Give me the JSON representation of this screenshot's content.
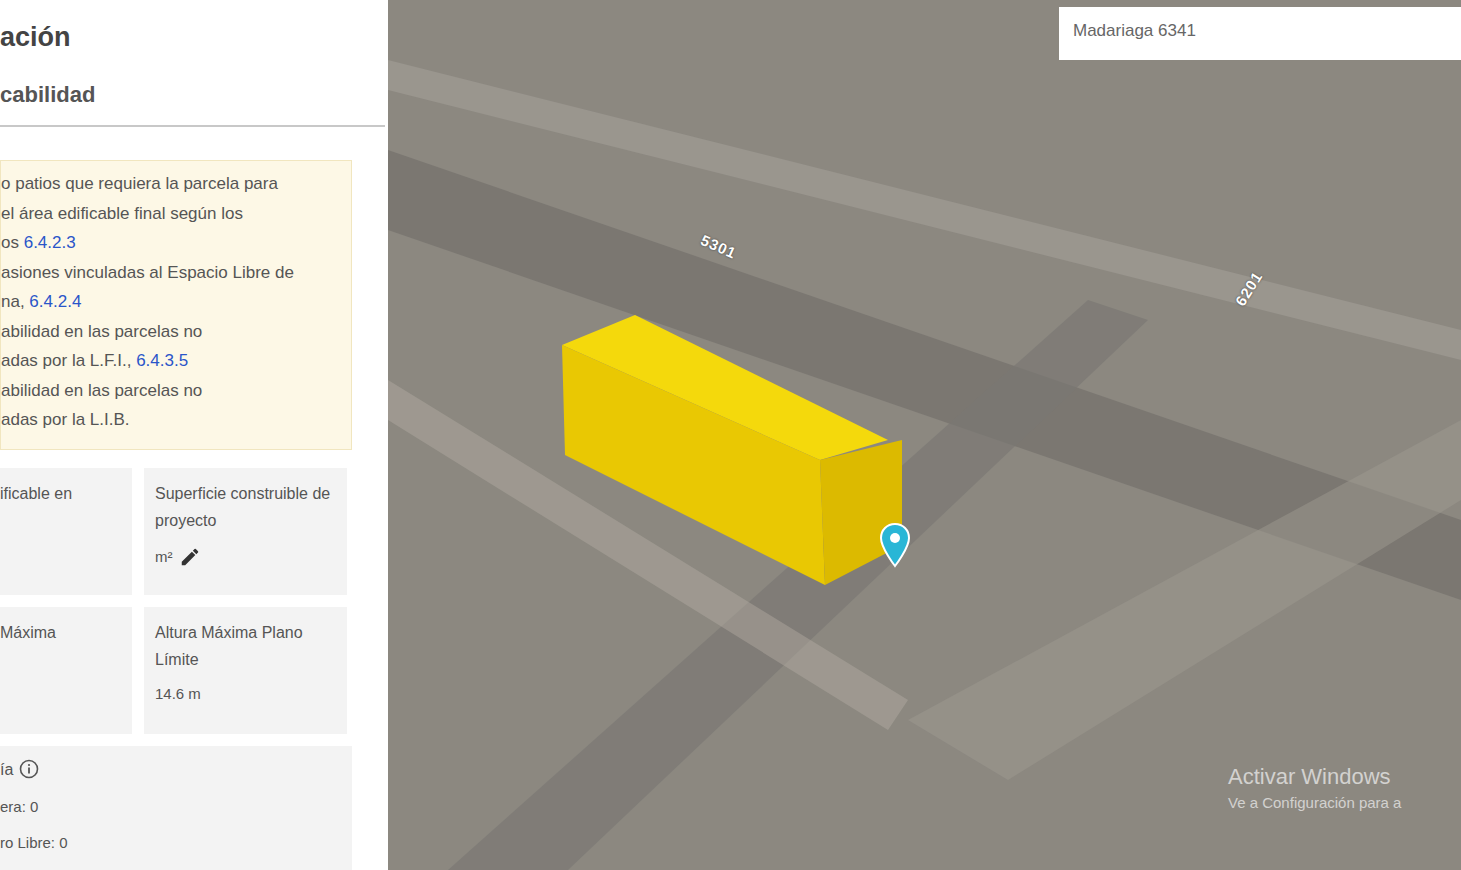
{
  "panel": {
    "title": "ación",
    "subtitle": "cabilidad",
    "note": [
      {
        "text": "o patios que requiera la parcela para",
        "link": ""
      },
      {
        "text": "el área edificable final según los",
        "link": ""
      },
      {
        "text": "os ",
        "link": "6.4.2.3"
      },
      {
        "text": "asiones vinculadas al Espacio Libre de",
        "link": ""
      },
      {
        "text": "na, ",
        "link": "6.4.2.4"
      },
      {
        "text": "abilidad en las parcelas no",
        "link": ""
      },
      {
        "text": "adas por la L.F.I., ",
        "link": "6.4.3.5"
      },
      {
        "text": "abilidad en las parcelas no",
        "link": ""
      },
      {
        "text": "adas por la L.I.B.",
        "link": ""
      }
    ]
  },
  "cards": [
    {
      "kind": "plain",
      "label": "ificable en",
      "value": ""
    },
    {
      "kind": "editable",
      "label": "Superficie construible de proyecto",
      "value": "m²"
    },
    {
      "kind": "plain",
      "label": "Máxima",
      "value": ""
    },
    {
      "kind": "plain",
      "label": "Altura Máxima Plano Límite",
      "value": "14.6 m"
    },
    {
      "kind": "info",
      "label": "ía",
      "lines": [
        "era: 0",
        "ro Libre: 0"
      ]
    }
  ],
  "map": {
    "search": "Madariaga 6341",
    "street_labels": [
      "5301",
      "6201"
    ]
  },
  "watermark": [
    "Activar Windows",
    "Ve a Configuración para a"
  ]
}
